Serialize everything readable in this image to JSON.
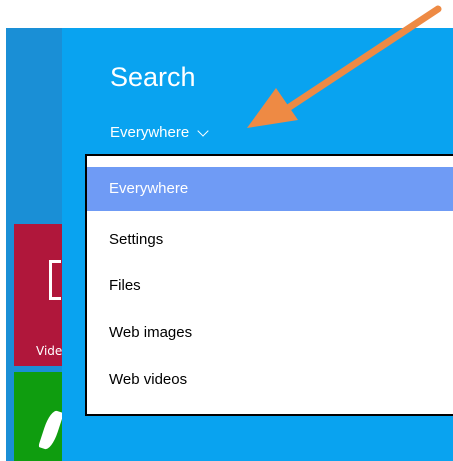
{
  "charm": {
    "title": "Search",
    "scope_label": "Everywhere"
  },
  "dropdown": {
    "options": [
      {
        "label": "Everywhere",
        "selected": true
      },
      {
        "label": "Settings",
        "selected": false
      },
      {
        "label": "Files",
        "selected": false
      },
      {
        "label": "Web images",
        "selected": false
      },
      {
        "label": "Web videos",
        "selected": false
      }
    ]
  },
  "start_tiles": {
    "video_label": "Vide"
  },
  "colors": {
    "charm_bg": "#09a3f0",
    "selected_bg": "#6f9bf5",
    "video_tile": "#b0173b",
    "green_tile": "#0f9d0f",
    "annotation_arrow": "#ee8a44"
  },
  "icons": {
    "chevron": "chevron-down-icon",
    "annotation": "arrow-pointer-icon"
  }
}
